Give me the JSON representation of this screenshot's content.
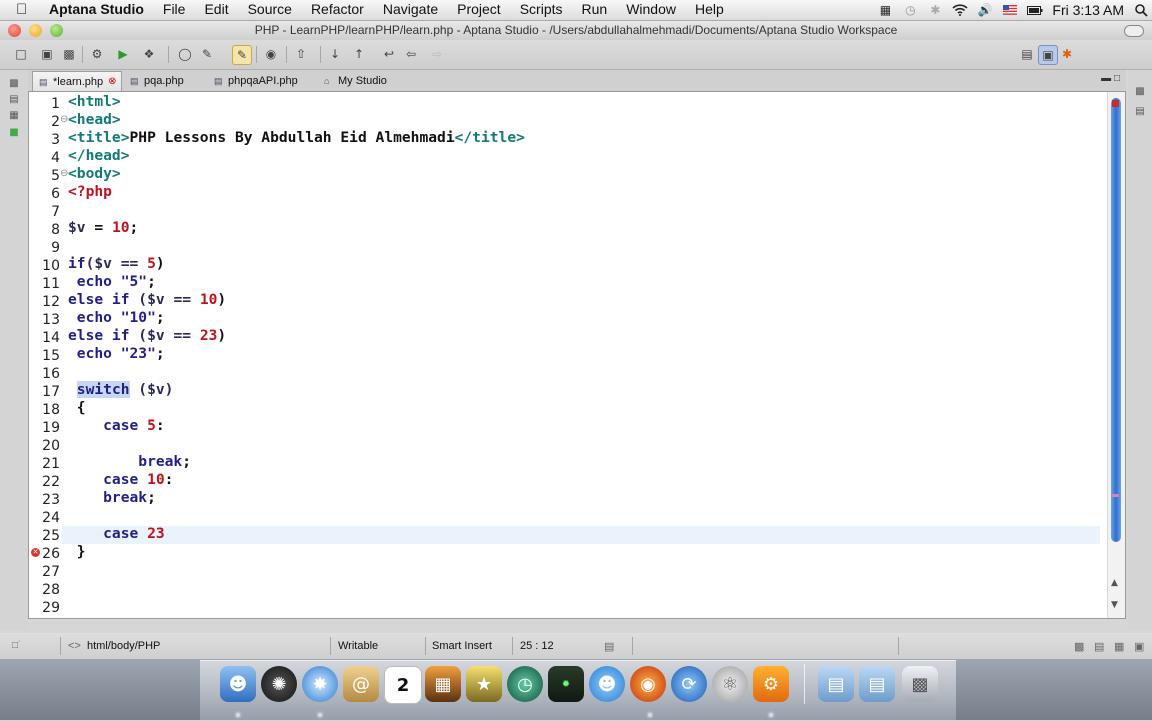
{
  "menubar": {
    "app_name": "Aptana Studio",
    "menus": [
      "File",
      "Edit",
      "Source",
      "Refactor",
      "Navigate",
      "Project",
      "Scripts",
      "Run",
      "Window",
      "Help"
    ],
    "clock": "Fri 3:13 AM"
  },
  "window": {
    "title": "PHP - LearnPHP/learnPHP/learn.php - Aptana Studio - /Users/abdullahalmehmadi/Documents/Aptana Studio Workspace"
  },
  "tabs": [
    {
      "label": "*learn.php",
      "active": true
    },
    {
      "label": "pqa.php",
      "active": false
    },
    {
      "label": "phpqaAPI.php",
      "active": false
    },
    {
      "label": "My Studio",
      "active": false
    }
  ],
  "editor": {
    "line_numbers": [
      "1",
      "2",
      "3",
      "4",
      "5",
      "6",
      "7",
      "8",
      "9",
      "10",
      "11",
      "12",
      "13",
      "14",
      "15",
      "16",
      "17",
      "18",
      "19",
      "20",
      "21",
      "22",
      "23",
      "24",
      "25",
      "26",
      "27",
      "28",
      "29"
    ],
    "current_line": 25,
    "error_line": 26,
    "code": {
      "l1_tag": "<html>",
      "l2_tag": "<head>",
      "l3_open": "<title>",
      "l3_text": "PHP Lessons By Abdullah Eid Almehmadi",
      "l3_close": "</title>",
      "l4_tag": "</head>",
      "l5_tag": "<body>",
      "l6_php": "<?php",
      "l8_var": "$v",
      "l8_op": " = ",
      "l8_num": "10",
      "l8_end": ";",
      "l10_kw": "if",
      "l10_a": "($v == ",
      "l10_num": "5",
      "l10_b": ")",
      "l11_kw": " echo ",
      "l11_str": "\"5\"",
      "l11_end": ";",
      "l12_kw": "else if ",
      "l12_a": "($v == ",
      "l12_num": "10",
      "l12_b": ")",
      "l13_kw": " echo ",
      "l13_str": "\"10\"",
      "l13_end": ";",
      "l14_kw": "else if ",
      "l14_a": "($v == ",
      "l14_num": "23",
      "l14_b": ")",
      "l15_kw": " echo ",
      "l15_str": "\"23\"",
      "l15_end": ";",
      "l17_pre": " ",
      "l17_kw": "switch",
      "l17_a": " ($v)",
      "l18": " {",
      "l19_kw": "    case ",
      "l19_num": "5",
      "l19_end": ":",
      "l21_kw": "        break",
      "l21_end": ";",
      "l22_kw": "    case ",
      "l22_num": "10",
      "l22_end": ":",
      "l23_kw": "    break",
      "l23_end": ";",
      "l25_kw": "    case ",
      "l25_num": "23",
      "l26": " }"
    }
  },
  "statusbar": {
    "breadcrumb": "html/body/PHP",
    "mode": "Writable",
    "insert": "Smart Insert",
    "position": "25 : 12"
  },
  "dock": {
    "calendar_day": "2",
    "items": [
      "finder-icon",
      "dashboard-icon",
      "safari-icon",
      "contacts-icon",
      "calendar-icon",
      "iphoto-icon",
      "imovie-icon",
      "time-machine-icon",
      "zoin-icon",
      "ichat-icon",
      "firefox-icon",
      "network-icon",
      "app-icon",
      "preferences-icon",
      "folder-icon",
      "folder-icon",
      "trash-icon"
    ]
  }
}
